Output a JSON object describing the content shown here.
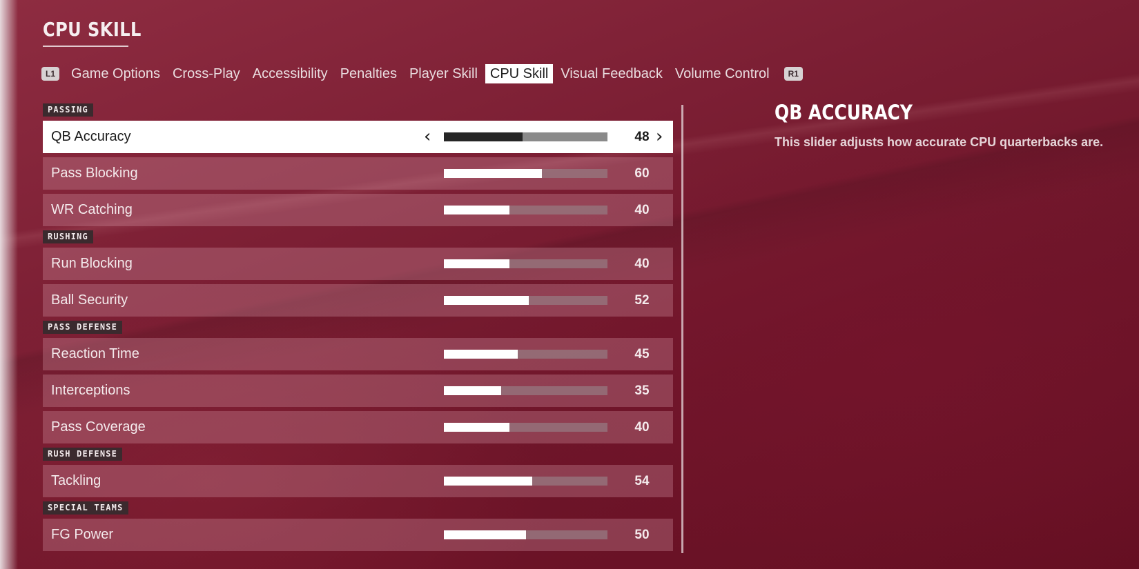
{
  "page": {
    "title": "CPU SKILL"
  },
  "tabs": {
    "left_bumper": "L1",
    "right_bumper": "R1",
    "items": [
      {
        "label": "Game Options"
      },
      {
        "label": "Cross-Play"
      },
      {
        "label": "Accessibility"
      },
      {
        "label": "Penalties"
      },
      {
        "label": "Player Skill"
      },
      {
        "label": "CPU Skill",
        "active": true
      },
      {
        "label": "Visual Feedback"
      },
      {
        "label": "Volume Control"
      }
    ]
  },
  "sections": [
    {
      "label": "PASSING",
      "rows": [
        {
          "label": "QB Accuracy",
          "value": "48",
          "selected": true
        },
        {
          "label": "Pass Blocking",
          "value": "60"
        },
        {
          "label": "WR Catching",
          "value": "40"
        }
      ]
    },
    {
      "label": "RUSHING",
      "rows": [
        {
          "label": "Run Blocking",
          "value": "40"
        },
        {
          "label": "Ball Security",
          "value": "52"
        }
      ]
    },
    {
      "label": "PASS DEFENSE",
      "rows": [
        {
          "label": "Reaction Time",
          "value": "45"
        },
        {
          "label": "Interceptions",
          "value": "35"
        },
        {
          "label": "Pass Coverage",
          "value": "40"
        }
      ]
    },
    {
      "label": "RUSH DEFENSE",
      "rows": [
        {
          "label": "Tackling",
          "value": "54"
        }
      ]
    },
    {
      "label": "SPECIAL TEAMS",
      "rows": [
        {
          "label": "FG Power",
          "value": "50"
        }
      ]
    }
  ],
  "slider_max": 100,
  "arrows": {
    "left": "‹",
    "right": "›"
  },
  "detail": {
    "title": "QB ACCURACY",
    "description": "This slider adjusts how accurate CPU quarterbacks are."
  },
  "colors": {
    "background": "#7c1f34",
    "selected_row": "#ffffff",
    "row": "#b3707f",
    "section_label_bg": "#3b2a2e"
  }
}
